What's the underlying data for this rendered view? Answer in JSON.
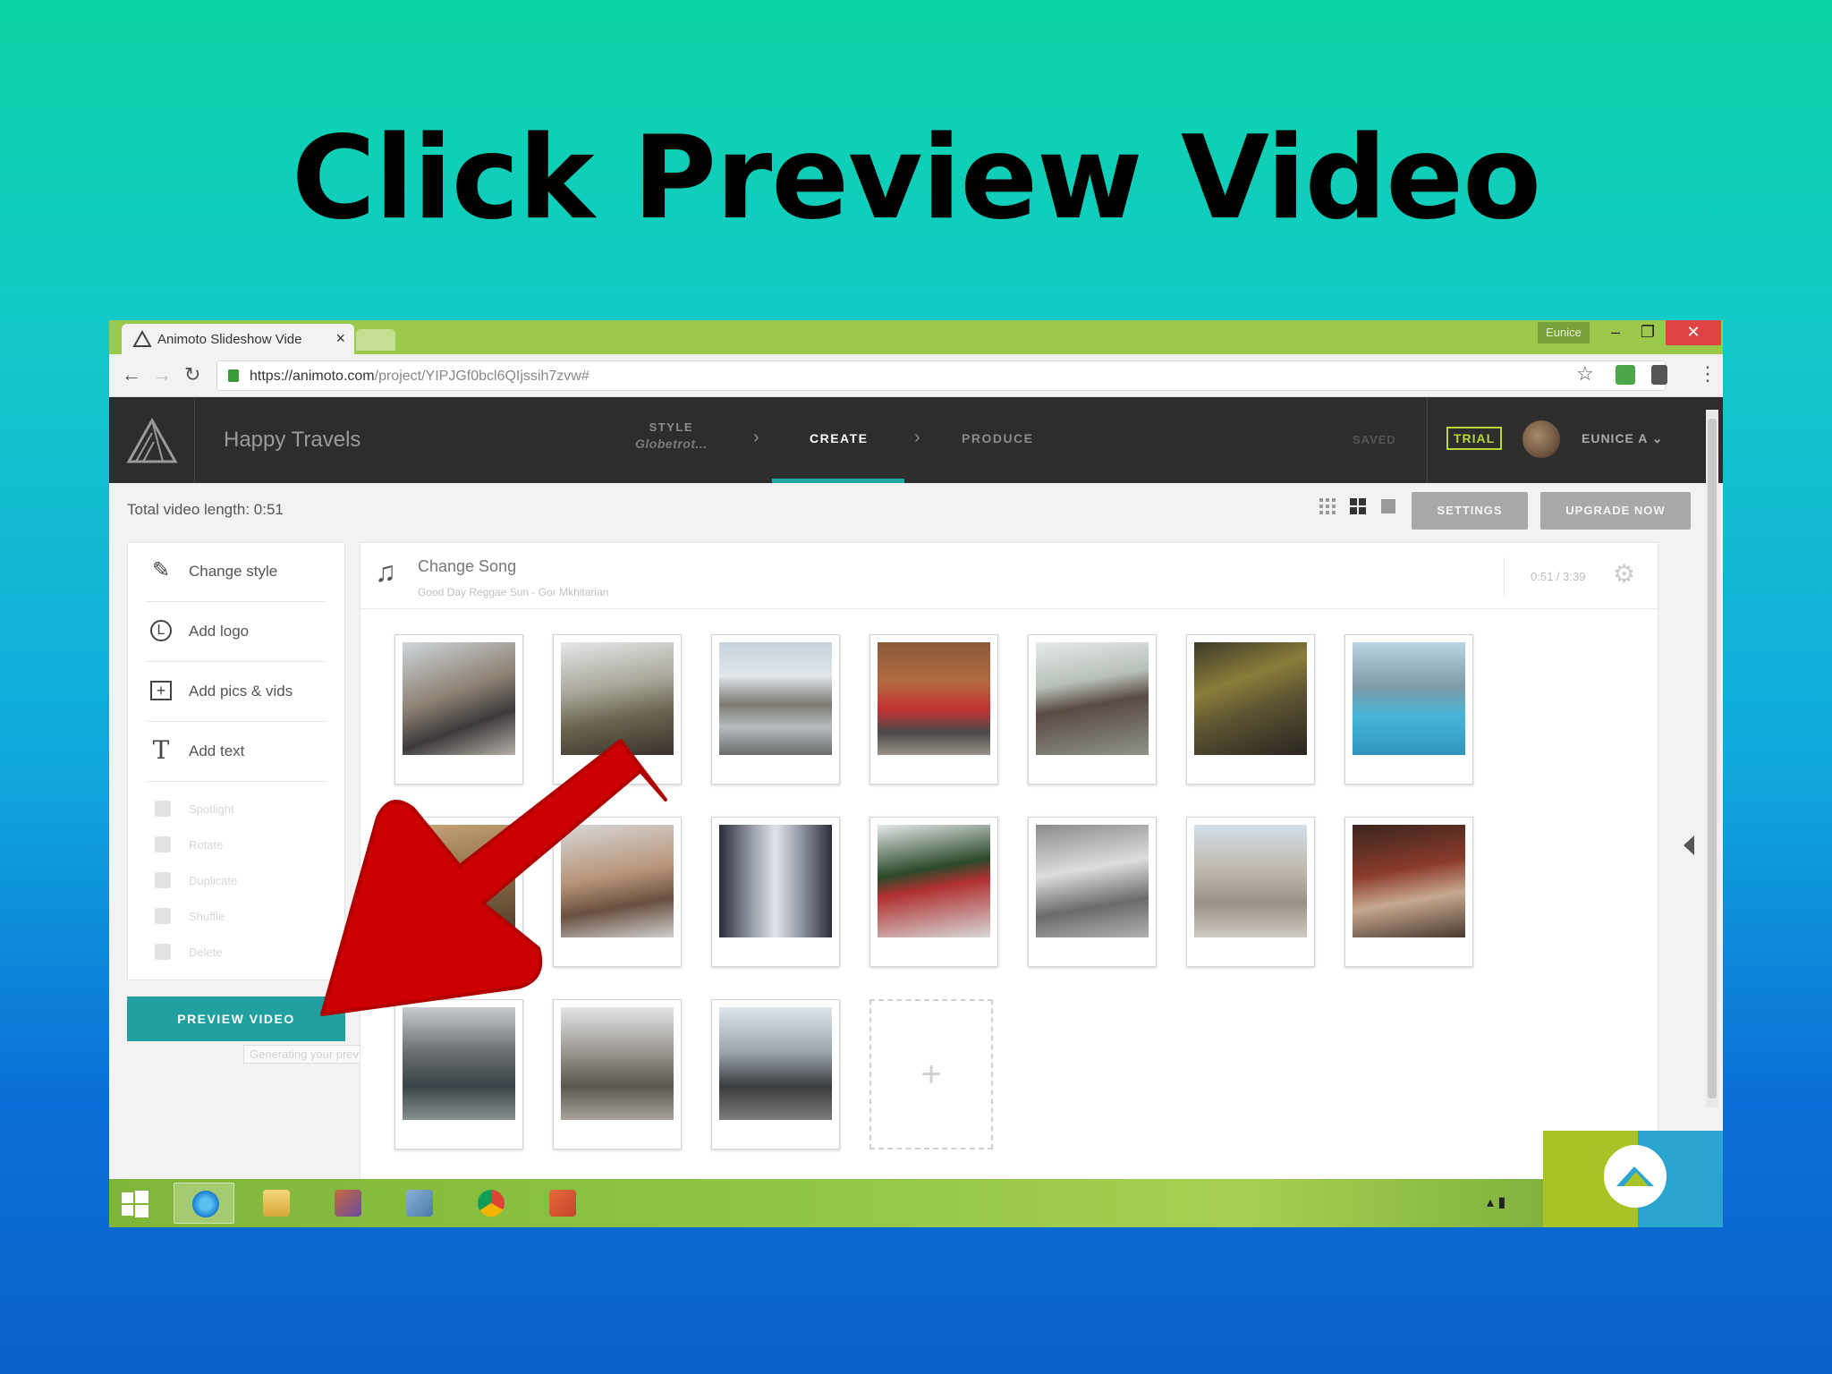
{
  "slide": {
    "title": "Click Preview Video"
  },
  "browser": {
    "tab_title": "Animoto Slideshow Vide",
    "user_badge": "Eunice",
    "url_host": "https://animoto.com",
    "url_path": "/project/YIPJGf0bcl6QIjssih7zvw#"
  },
  "header": {
    "project_title": "Happy Travels",
    "steps": {
      "style_label": "STYLE",
      "style_value": "Globetrot...",
      "create_label": "CREATE",
      "produce_label": "PRODUCE"
    },
    "saved_label": "SAVED",
    "trial_label": "TRIAL",
    "user_name": "EUNICE A"
  },
  "toolbar": {
    "video_length": "Total video length: 0:51",
    "settings_label": "SETTINGS",
    "upgrade_label": "UPGRADE NOW"
  },
  "sidebar": {
    "items": [
      {
        "label": "Change style",
        "icon": "brush-icon"
      },
      {
        "label": "Add logo",
        "icon": "logo-icon"
      },
      {
        "label": "Add pics & vids",
        "icon": "add-media-icon"
      },
      {
        "label": "Add text",
        "icon": "text-icon"
      }
    ],
    "faded_items": [
      {
        "label": "Spotlight"
      },
      {
        "label": "Rotate"
      },
      {
        "label": "Duplicate"
      },
      {
        "label": "Shuffle"
      },
      {
        "label": "Delete"
      }
    ],
    "preview_label": "PREVIEW VIDEO",
    "generating_text": "Generating your preview..."
  },
  "song": {
    "title": "Change Song",
    "artist": "Good Day Reggae Sun - Gor Mkhitarian",
    "time": "0:51 / 3:39"
  },
  "colors": {
    "accent_teal": "#21a0a0",
    "header_dark": "#2d2d2d",
    "trial_green": "#b6d83a",
    "arrow_red": "#cc0000"
  }
}
